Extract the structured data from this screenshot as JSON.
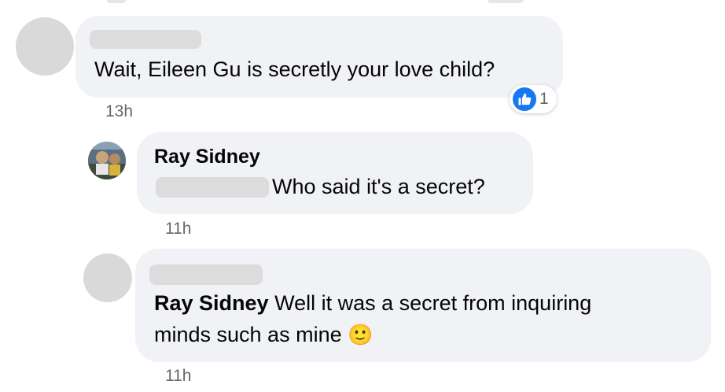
{
  "comments": [
    {
      "text": "Wait, Eileen Gu is secretly your love child?",
      "time": "13h",
      "reaction": {
        "icon": "like-icon",
        "count": "1"
      }
    },
    {
      "author": "Ray Sidney",
      "text": "Who said it's a secret?",
      "time": "11h"
    },
    {
      "author": "Ray Sidney",
      "text_line1": "Well it was a secret from inquiring",
      "text_line2": "minds such as mine",
      "emoji": "🙂",
      "time": "11h"
    }
  ],
  "colors": {
    "bubble": "#f0f2f5",
    "accent": "#1877f2",
    "muted": "#65676b"
  }
}
